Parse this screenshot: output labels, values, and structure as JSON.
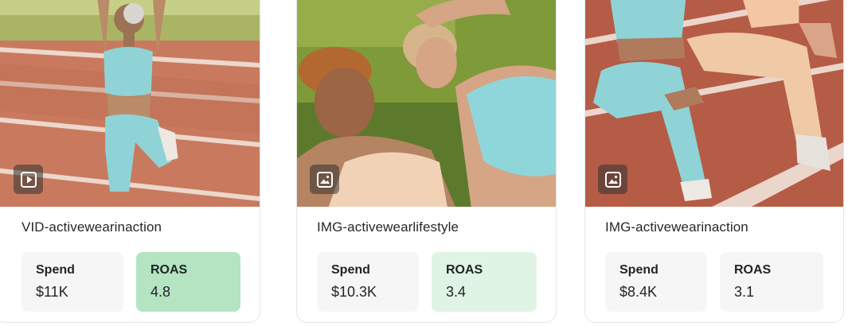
{
  "cards": [
    {
      "media_type": "video",
      "media_icon": "play-icon",
      "title": "VID-activewearinaction",
      "spend_label": "Spend",
      "spend_value": "$11K",
      "roas_label": "ROAS",
      "roas_value": "4.8",
      "roas_bg": "#b5e4c2"
    },
    {
      "media_type": "image",
      "media_icon": "image-icon",
      "title": "IMG-activewearlifestyle",
      "spend_label": "Spend",
      "spend_value": "$10.3K",
      "roas_label": "ROAS",
      "roas_value": "3.4",
      "roas_bg": "#dff4e4"
    },
    {
      "media_type": "image",
      "media_icon": "image-icon",
      "title": "IMG-activewearinaction",
      "spend_label": "Spend",
      "spend_value": "$8.4K",
      "roas_label": "ROAS",
      "roas_value": "3.1",
      "roas_bg": "#f6f6f6"
    }
  ]
}
